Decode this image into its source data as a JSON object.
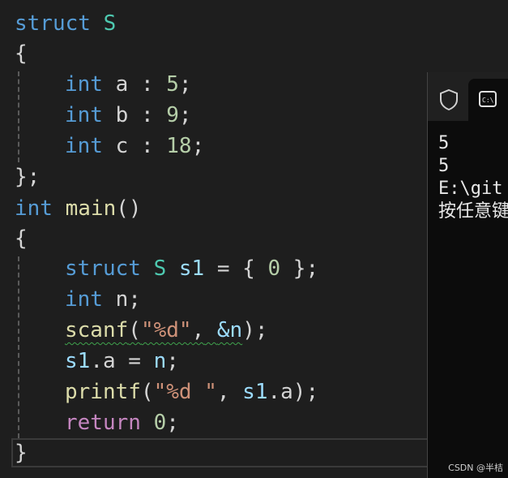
{
  "editor": {
    "line1": {
      "kw": "struct",
      "name": "S"
    },
    "line2": {
      "brace": "{"
    },
    "line3": {
      "type": "int",
      "field": "a",
      "sep": ":",
      "bits": "5",
      "end": ";"
    },
    "line4": {
      "type": "int",
      "field": "b",
      "sep": ":",
      "bits": "9",
      "end": ";"
    },
    "line5": {
      "type": "int",
      "field": "c",
      "sep": ":",
      "bits": "18",
      "end": ";"
    },
    "line6": {
      "close": "};"
    },
    "line7": {
      "type": "int",
      "fn": "main",
      "parens": "()"
    },
    "line8": {
      "brace": "{"
    },
    "line9": {
      "kw": "struct",
      "name": "S",
      "var": "s1",
      "assign": "=",
      "init_open": "{",
      "zero": "0",
      "init_close": "};"
    },
    "line10": {
      "type": "int",
      "var": "n",
      "end": ";"
    },
    "line11": {
      "fn": "scanf",
      "open": "(",
      "fmt": "\"%d\"",
      "comma": ",",
      "arg": "&n",
      "close": ");"
    },
    "line12": {
      "var": "s1",
      "dot": ".",
      "member": "a",
      "assign": "=",
      "rhs": "n",
      "end": ";"
    },
    "line13": {
      "fn": "printf",
      "open": "(",
      "fmt": "\"%d \"",
      "comma": ",",
      "arg_var": "s1",
      "dot": ".",
      "arg_member": "a",
      "close": ");"
    },
    "line14": {
      "kw": "return",
      "zero": "0",
      "end": ";"
    },
    "line15": {
      "brace": "}"
    }
  },
  "console": {
    "tab_shield_icon": "shield-icon",
    "tab_cmd_icon": "cmd-icon",
    "output": [
      "5",
      "5",
      "E:\\git",
      "按任意键"
    ]
  },
  "watermark": "CSDN @半桔",
  "colors": {
    "keyword": "#569cd6",
    "control": "#c586c0",
    "type": "#4ec9b0",
    "number": "#b5cea8",
    "string": "#ce9178",
    "function": "#dcdcaa",
    "variable": "#9cdcfe",
    "text": "#d4d4d4",
    "background": "#1e1e1e"
  }
}
